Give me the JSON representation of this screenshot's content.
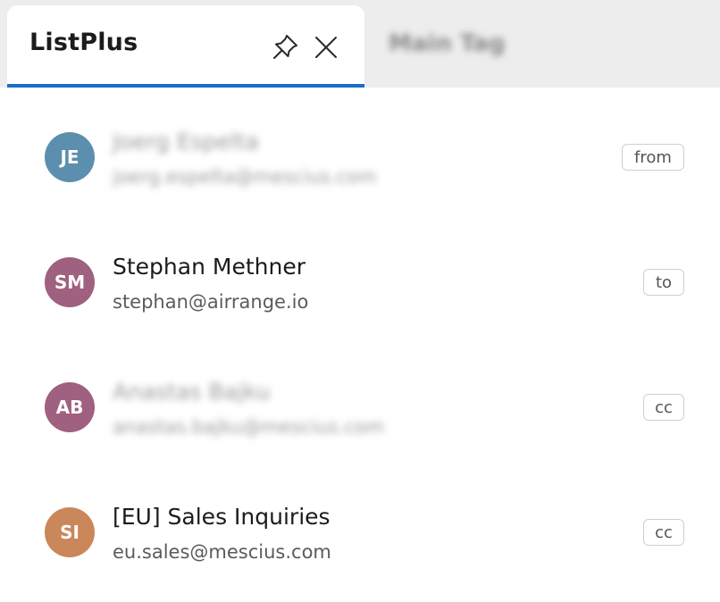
{
  "tabs": {
    "active": {
      "title": "ListPlus"
    },
    "inactive": {
      "title": "Main Tag"
    }
  },
  "icons": {
    "pin": "pin-icon",
    "close": "close-icon"
  },
  "colors": {
    "accent": "#1a6fc4",
    "avatar_je": "#5b8fad",
    "avatar_sm": "#a0607f",
    "avatar_ab": "#a0607f",
    "avatar_si": "#c9875a"
  },
  "recipients": [
    {
      "initials": "JE",
      "name": "Joerg Espelta",
      "email": "joerg.espelta@mescius.com",
      "role": "from",
      "blurred": true
    },
    {
      "initials": "SM",
      "name": "Stephan Methner",
      "email": "stephan@airrange.io",
      "role": "to",
      "blurred": false
    },
    {
      "initials": "AB",
      "name": "Anastas Bajku",
      "email": "anastas.bajku@mescius.com",
      "role": "cc",
      "blurred": true
    },
    {
      "initials": "SI",
      "name": "[EU] Sales Inquiries",
      "email": "eu.sales@mescius.com",
      "role": "cc",
      "blurred": false
    }
  ]
}
